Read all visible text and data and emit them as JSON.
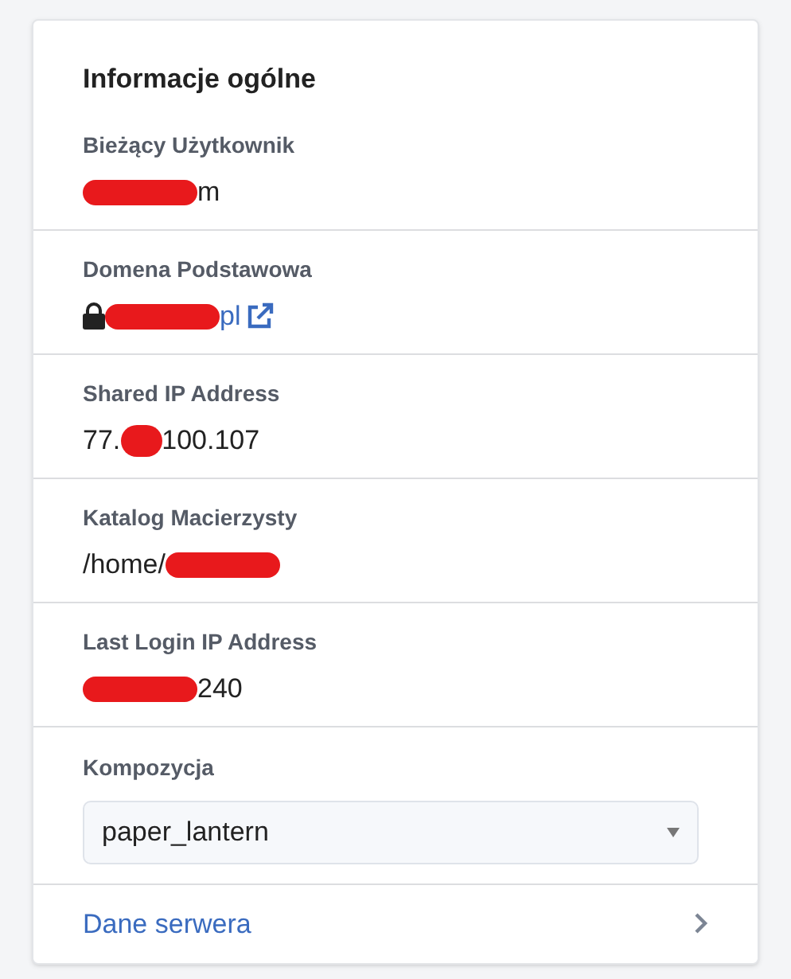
{
  "title": "Informacje ogólne",
  "fields": [
    {
      "kind": "text",
      "label": "Bieżący Użytkownik",
      "value": [
        {
          "kind": "redaction"
        },
        {
          "kind": "text",
          "text": "m"
        }
      ]
    },
    {
      "kind": "link",
      "label": "Domena Podstawowa",
      "value": [
        {
          "kind": "redaction"
        },
        {
          "kind": "text",
          "text": "pl"
        }
      ]
    },
    {
      "kind": "text",
      "label": "Shared IP Address",
      "value": [
        {
          "kind": "text",
          "text": "77."
        },
        {
          "kind": "short-redaction"
        },
        {
          "kind": "text",
          "text": "100.107"
        }
      ]
    },
    {
      "kind": "text",
      "label": "Katalog Macierzysty",
      "value": [
        {
          "kind": "text",
          "text": "/home/"
        },
        {
          "kind": "redaction"
        }
      ]
    },
    {
      "kind": "text",
      "label": "Last Login IP Address",
      "value": [
        {
          "kind": "redaction"
        },
        {
          "kind": "text",
          "text": "240"
        }
      ]
    },
    {
      "kind": "select",
      "label": "Kompozycja",
      "value": [
        {
          "kind": "text",
          "text": "paper_lantern"
        }
      ]
    }
  ],
  "footer_link": "Dane serwera"
}
